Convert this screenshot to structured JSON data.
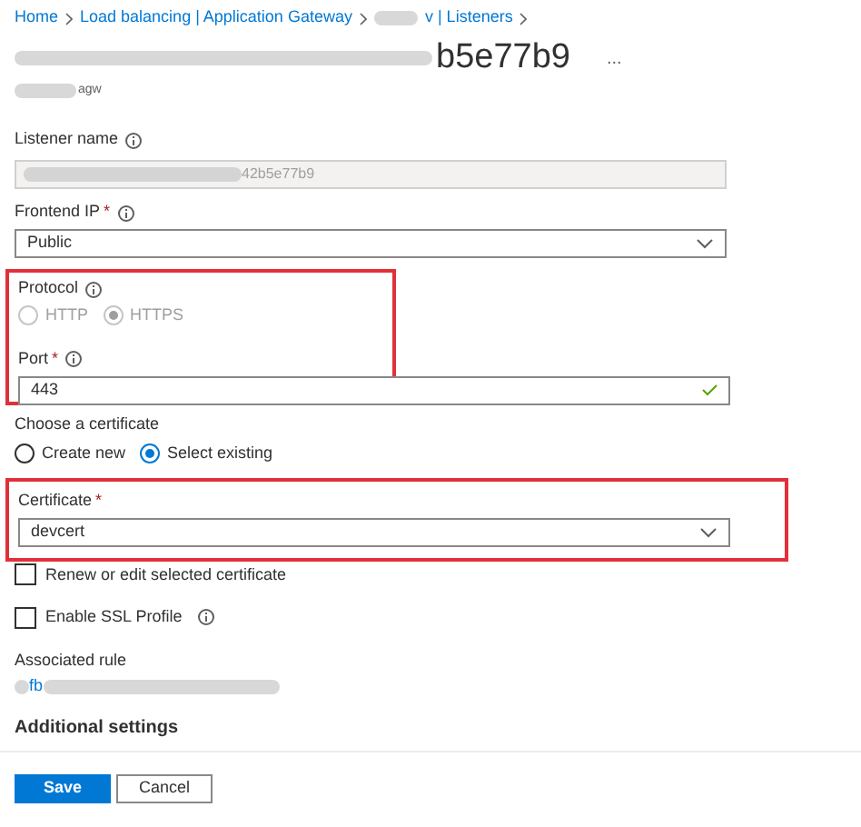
{
  "breadcrumb": [
    {
      "label": "Home"
    },
    {
      "label": "Load balancing | Application Gateway"
    },
    {
      "label": "v | Listeners"
    }
  ],
  "required_mark": "*",
  "title": "b5e77b9",
  "more": "...",
  "subtitle": "agw",
  "listener_name": {
    "label": "Listener name",
    "value": "42b5e77b9",
    "disabled": true
  },
  "frontend_ip": {
    "label": "Frontend IP",
    "required": true,
    "value": "Public"
  },
  "protocol": {
    "label": "Protocol",
    "disabled": true,
    "options": [
      {
        "label": "HTTP",
        "selected": false
      },
      {
        "label": "HTTPS",
        "selected": true
      }
    ]
  },
  "port": {
    "label": "Port",
    "required": true,
    "value": "443",
    "valid": true
  },
  "choose_certificate": {
    "label": "Choose a certificate",
    "options": [
      {
        "label": "Create new",
        "selected": false
      },
      {
        "label": "Select existing",
        "selected": true
      }
    ]
  },
  "certificate": {
    "label": "Certificate",
    "required": true,
    "value": "devcert"
  },
  "checkboxes": [
    {
      "label": "Renew or edit selected certificate",
      "checked": false,
      "info": false
    },
    {
      "label": "Enable SSL Profile",
      "checked": false,
      "info": true
    }
  ],
  "associated_rule": {
    "label": "Associated rule",
    "link": "fb"
  },
  "additional_settings": "Additional settings",
  "buttons": [
    {
      "label": "Save",
      "kind": "primary"
    },
    {
      "label": "Cancel",
      "kind": "secondary"
    }
  ]
}
